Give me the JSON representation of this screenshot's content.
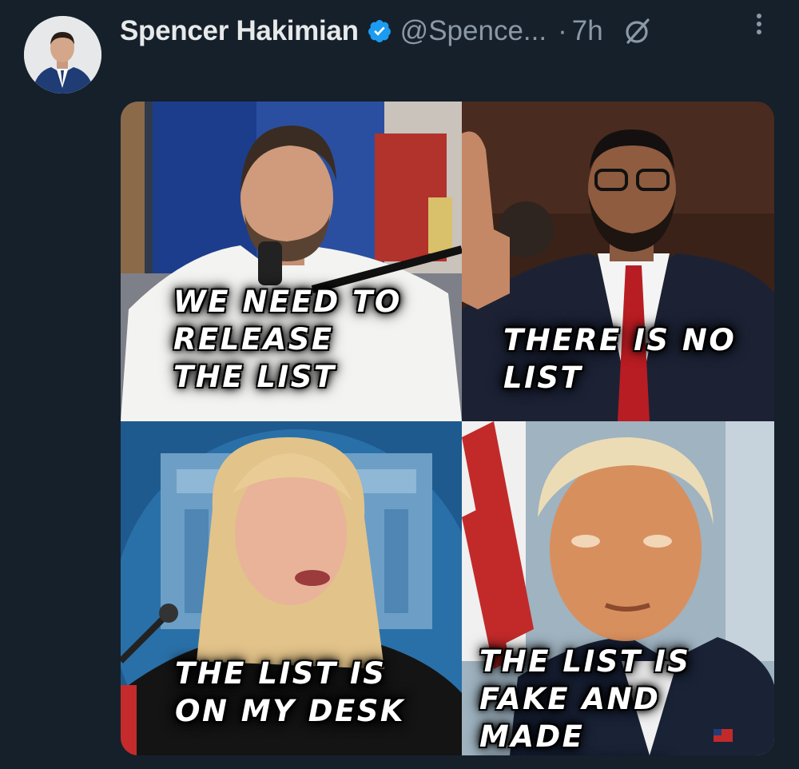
{
  "tweet": {
    "author_name": "Spencer Hakimian",
    "handle": "@Spence...",
    "separator": "·",
    "time": "7h"
  },
  "icons": {
    "verified": "verified-badge-icon",
    "grok": "grok-icon",
    "more": "more-vertical-icon"
  },
  "colors": {
    "background": "#15202b",
    "verified": "#1d9bf0",
    "secondary_text": "#8b98a5"
  },
  "meme": {
    "panels": [
      {
        "caption": "WE NEED TO\nRELEASE\nTHE LIST"
      },
      {
        "caption": "THERE IS NO\nLIST"
      },
      {
        "caption": "THE LIST IS\nON MY DESK"
      },
      {
        "caption": "THE LIST IS\nFAKE AND MADE\nBY OBAMA"
      }
    ]
  }
}
